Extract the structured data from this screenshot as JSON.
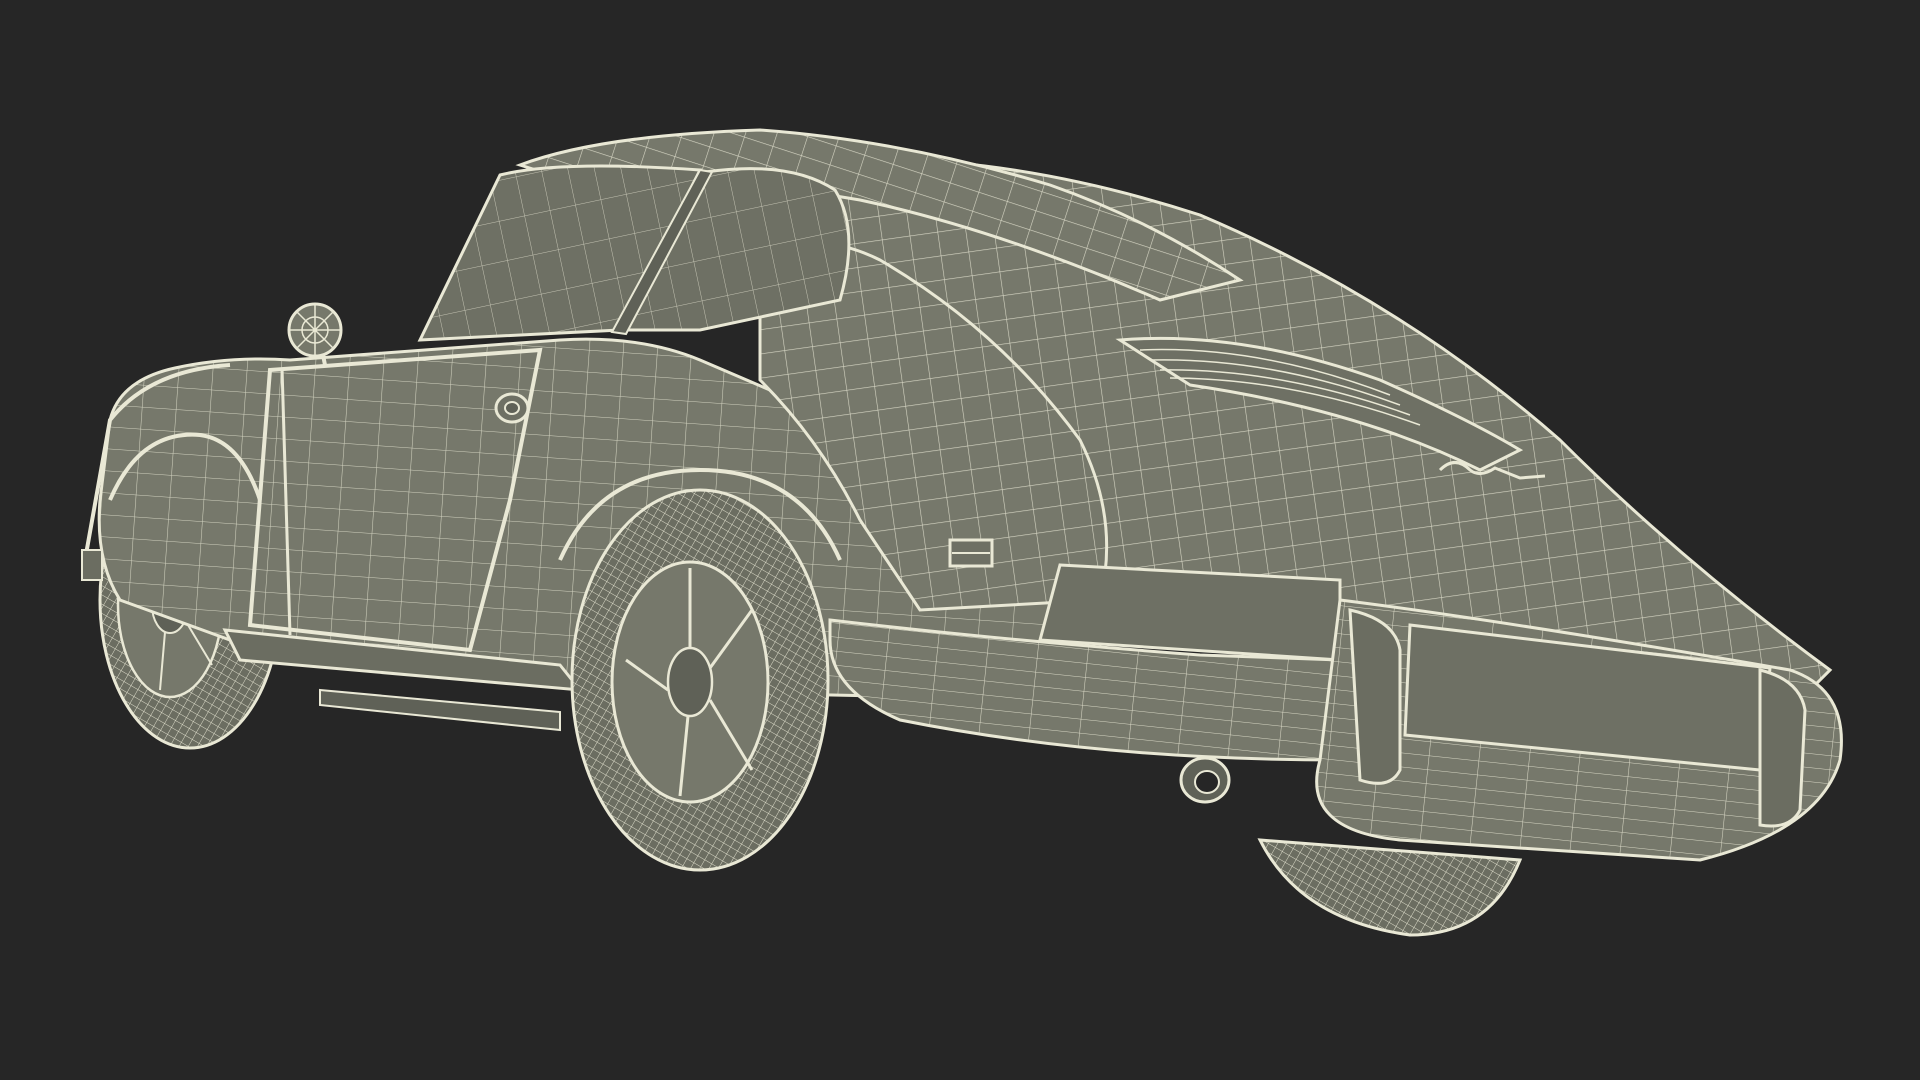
{
  "scene": {
    "background_color": "#262626",
    "surface_color": "#76786b",
    "surface_dark_color": "#5f6157",
    "wire_color": "#e9e8d5",
    "wire_dim_color": "#cfcdb9",
    "subject": "car-wireframe-render"
  }
}
